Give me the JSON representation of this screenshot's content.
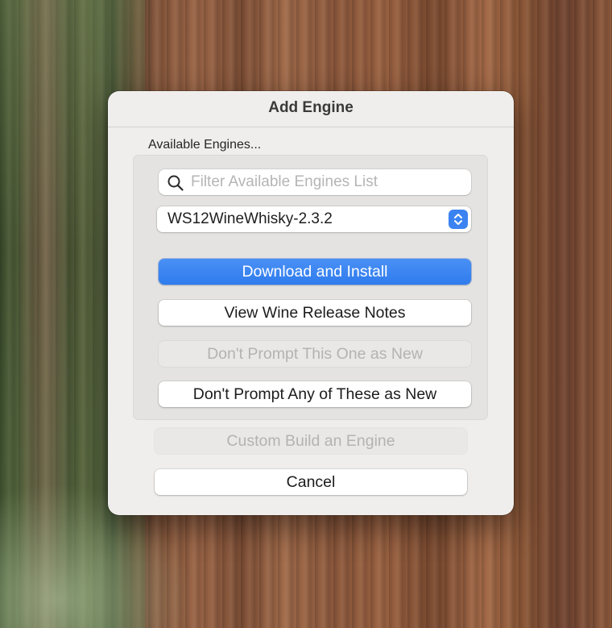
{
  "dialog": {
    "title": "Add Engine",
    "section_label": "Available Engines..."
  },
  "search": {
    "placeholder": "Filter Available Engines List",
    "value": "",
    "icon": "search-icon"
  },
  "engine_select": {
    "selected": "WS12WineWhisky-2.3.2",
    "icon": "up-down-chevron-icon"
  },
  "buttons": {
    "download_install": "Download and Install",
    "view_release_notes": "View Wine Release Notes",
    "dont_prompt_one": "Don't Prompt This One as New",
    "dont_prompt_any": "Don't Prompt Any of These as New",
    "custom_build": "Custom Build an Engine",
    "cancel": "Cancel"
  },
  "colors": {
    "accent": "#2f7cee",
    "dialog_bg": "#efeeec",
    "disabled_text": "#b3b3b3"
  }
}
